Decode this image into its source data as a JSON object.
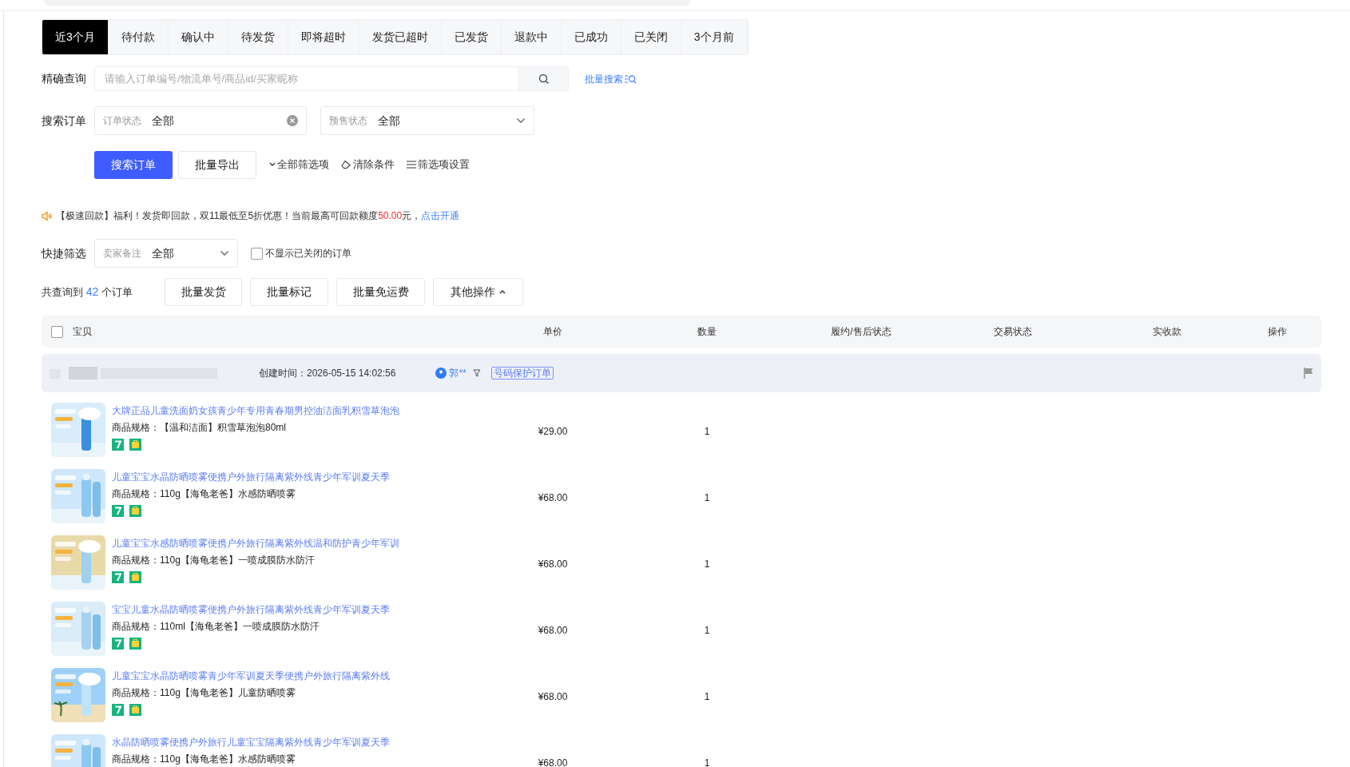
{
  "tabs": [
    {
      "label": "近3个月",
      "selected": true
    },
    {
      "label": "待付款",
      "selected": false
    },
    {
      "label": "确认中",
      "selected": false
    },
    {
      "label": "待发货",
      "selected": false
    },
    {
      "label": "即将超时",
      "selected": false
    },
    {
      "label": "发货已超时",
      "selected": false
    },
    {
      "label": "已发货",
      "selected": false
    },
    {
      "label": "退款中",
      "selected": false
    },
    {
      "label": "已成功",
      "selected": false
    },
    {
      "label": "已关闭",
      "selected": false
    },
    {
      "label": "3个月前",
      "selected": false
    }
  ],
  "exact_search": {
    "label": "精确查询",
    "placeholder": "请输入订单编号/物流单号/商品id/买家昵称",
    "batch_link": "批量搜索"
  },
  "search_orders": {
    "label": "搜索订单",
    "filters": [
      {
        "label": "订单状态",
        "value": "全部",
        "kind": "clearable"
      },
      {
        "label": "预售状态",
        "value": "全部",
        "kind": "dropdown"
      }
    ]
  },
  "actions": {
    "primary": "搜索订单",
    "export": "批量导出",
    "links": [
      "全部筛选项",
      "清除条件",
      "筛选项设置"
    ]
  },
  "notice": {
    "text": "【极速回款】福利！发货即回款，双11最低至5折优惠！当前最高可回款额度",
    "amount": "50.00",
    "after": "元，",
    "link": "点击开通"
  },
  "quick_filter": {
    "label": "快捷筛选",
    "select_label": "卖家备注",
    "select_value": "全部",
    "checkbox": {
      "label": "不显示已关闭的订单",
      "checked": false
    }
  },
  "summary": {
    "prefix": "共查询到",
    "count": "42",
    "suffix": "个订单"
  },
  "bulk_buttons": [
    {
      "label": "批量发货",
      "kind": "button"
    },
    {
      "label": "批量标记",
      "kind": "button"
    },
    {
      "label": "批量免运费",
      "kind": "button"
    },
    {
      "label": "其他操作",
      "kind": "menu"
    }
  ],
  "table": {
    "select_all_checked": false,
    "columns": [
      "宝贝",
      "单价",
      "数量",
      "履约/售后状态",
      "交易状态",
      "实收款",
      "操作"
    ]
  },
  "order": {
    "created": "创建时间：2026-05-15 14:02:56",
    "buyer": "郭**",
    "badge": "号码保护订单",
    "items": [
      {
        "title": "大牌正品儿童洗面奶女孩青少年专用青春期男控油洁面乳积雪草泡泡",
        "spec": "商品规格：【温和洁面】积雪草泡泡80ml",
        "price": "¥29.00",
        "quantity": "1"
      },
      {
        "title": "儿童宝宝水晶防晒喷雾便携户外旅行隔离紫外线青少年军训夏天季",
        "spec": "商品规格：110g【海龟老爸】水感防晒喷雾",
        "price": "¥68.00",
        "quantity": "1"
      },
      {
        "title": "儿童宝宝水感防晒喷雾便携户外旅行隔离紫外线温和防护青少年军训",
        "spec": "商品规格：110g【海龟老爸】一喷成膜防水防汗",
        "price": "¥68.00",
        "quantity": "1"
      },
      {
        "title": "宝宝儿童水晶防晒喷雾便携户外旅行隔离紫外线青少年军训夏天季",
        "spec": "商品规格：110ml【海龟老爸】一喷成膜防水防汗",
        "price": "¥68.00",
        "quantity": "1"
      },
      {
        "title": "儿童宝宝水晶防晒喷雾青少年军训夏天季便携户外旅行隔离紫外线",
        "spec": "商品规格：110g【海龟老爸】儿童防晒喷雾",
        "price": "¥68.00",
        "quantity": "1"
      },
      {
        "title": "水晶防晒喷雾便携户外旅行儿童宝宝隔离紫外线青少年军训夏天季",
        "spec": "商品规格：110g【海龟老爸】水感防晒喷雾",
        "price": "¥68.00",
        "quantity": "1"
      }
    ]
  }
}
